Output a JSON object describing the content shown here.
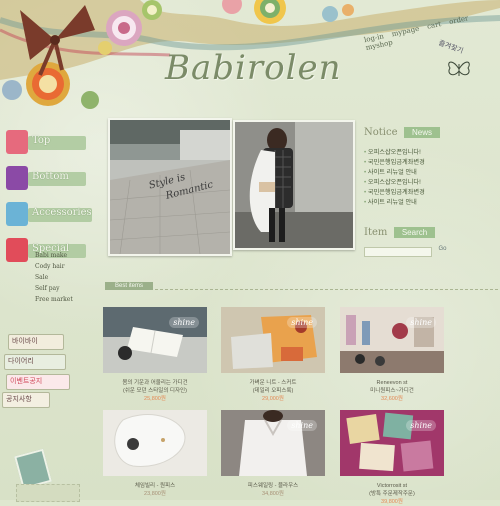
{
  "header": {
    "logo": "Babirolen",
    "top_links": [
      "log-in",
      "mypage",
      "cart",
      "order",
      "myshop"
    ],
    "bookmark": "즐겨찾기"
  },
  "nav": {
    "items": [
      {
        "label": "Top"
      },
      {
        "label": "Bottom"
      },
      {
        "label": "Accessories"
      },
      {
        "label": "Special"
      }
    ],
    "submenu": [
      "Babi make",
      "Cody hair",
      "Sale",
      "Self pay",
      "Free market"
    ]
  },
  "hero": {
    "caption_line1": "Style is",
    "caption_line2": "Romantic"
  },
  "notice": {
    "title": "Notice",
    "badge": "News",
    "items": [
      "오피스샵오픈입니다!",
      "국민은행입금계좌변경",
      "사이트 리뉴얼 안내",
      "오피스샵오픈입니다!",
      "국민은행입금계좌변경",
      "사이트 리뉴얼 안내"
    ]
  },
  "search": {
    "title": "Item",
    "badge": "Search",
    "go": "Go"
  },
  "best": {
    "label": "Best items"
  },
  "left_banners": [
    "바이바이",
    "다이어리",
    "이벤트공지",
    "공지사항"
  ],
  "products": [
    {
      "name": "봄의 기운과 어울리는 가디건",
      "sub": "(쉬운 모던 스타일의 디자인)",
      "price": "25,800원"
    },
    {
      "name": "가벼운 니트 - 스커트",
      "sub": "(데일리 오피스룩)",
      "price": "29,000원"
    },
    {
      "name": "Reneevon st",
      "sub": "미니원피스~가디건",
      "price": "32,600원"
    },
    {
      "name": "체임빌리 - 원피스",
      "sub": "",
      "price": "23,800원"
    },
    {
      "name": "피스웨일링 - 블라우스",
      "sub": "",
      "price": "34,800원"
    },
    {
      "name": "Victorrosit st",
      "sub": "(방특 주문제작주문)",
      "price": "39,800원"
    }
  ],
  "colors": {
    "background": "#dfe7cf",
    "accent": "#9ec18f",
    "price": "#e48a55"
  }
}
